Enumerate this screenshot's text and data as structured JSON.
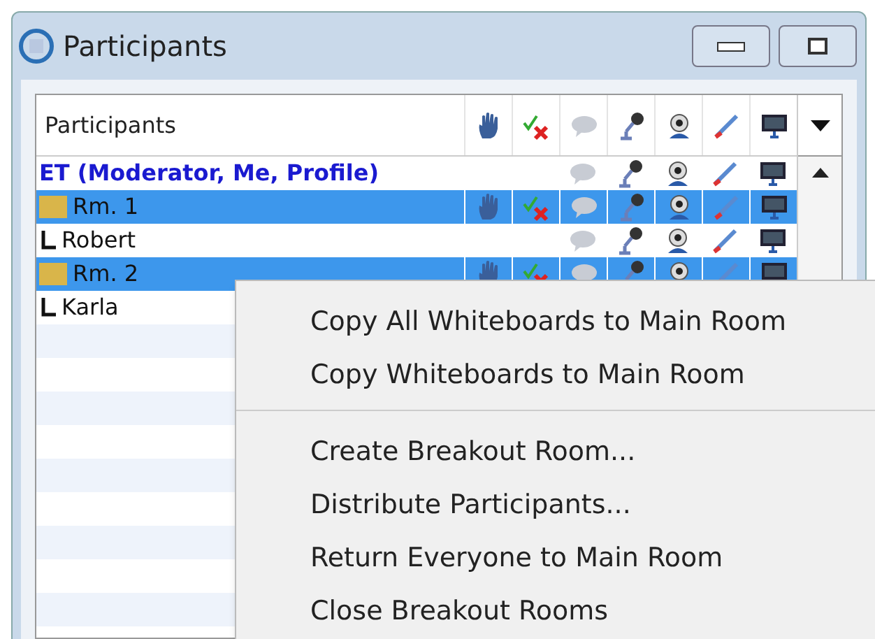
{
  "window": {
    "title": "Participants"
  },
  "table": {
    "column_header": "Participants",
    "rows": [
      {
        "name": "ET (Moderator, Me, Profile)",
        "kind": "self",
        "selected": false
      },
      {
        "name": "Rm. 1",
        "kind": "room",
        "selected": true
      },
      {
        "name": "Robert",
        "kind": "person",
        "selected": false
      },
      {
        "name": "Rm. 2",
        "kind": "room",
        "selected": true
      },
      {
        "name": "Karla",
        "kind": "person_under_menu",
        "selected": false
      }
    ]
  },
  "context_menu": {
    "groups": [
      [
        "Copy All Whiteboards to Main Room",
        "Copy Whiteboards to Main Room"
      ],
      [
        "Create Breakout Room...",
        "Distribute Participants...",
        "Return Everyone to Main Room",
        "Close Breakout Rooms"
      ]
    ]
  }
}
